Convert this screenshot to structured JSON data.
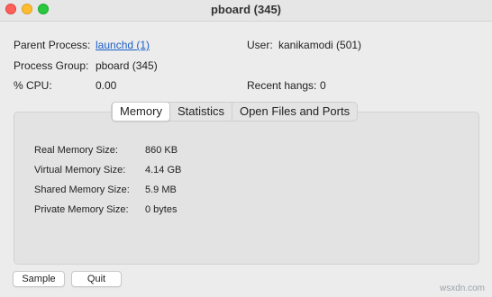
{
  "window": {
    "title": "pboard (345)"
  },
  "info": {
    "parent_process_label": "Parent Process:",
    "parent_process_value": "launchd (1)",
    "user_label": "User:",
    "user_value": "kanikamodi (501)",
    "process_group_label": "Process Group:",
    "process_group_value": "pboard (345)",
    "cpu_label": "% CPU:",
    "cpu_value": "0.00",
    "recent_hangs_label": "Recent hangs:",
    "recent_hangs_value": "0"
  },
  "tabs": [
    {
      "label": "Memory",
      "active": true
    },
    {
      "label": "Statistics",
      "active": false
    },
    {
      "label": "Open Files and Ports",
      "active": false
    }
  ],
  "memory": {
    "rows": [
      {
        "label": "Real Memory Size:",
        "value": "860 KB"
      },
      {
        "label": "Virtual Memory Size:",
        "value": "4.14 GB"
      },
      {
        "label": "Shared Memory Size:",
        "value": "5.9 MB"
      },
      {
        "label": "Private Memory Size:",
        "value": "0 bytes"
      }
    ]
  },
  "buttons": {
    "sample": "Sample",
    "quit": "Quit"
  },
  "watermark": "wsxdn.com",
  "colors": {
    "link": "#1a5fc9",
    "close": "#fe5f57",
    "minimize": "#febc2e",
    "maximize": "#28c840"
  }
}
